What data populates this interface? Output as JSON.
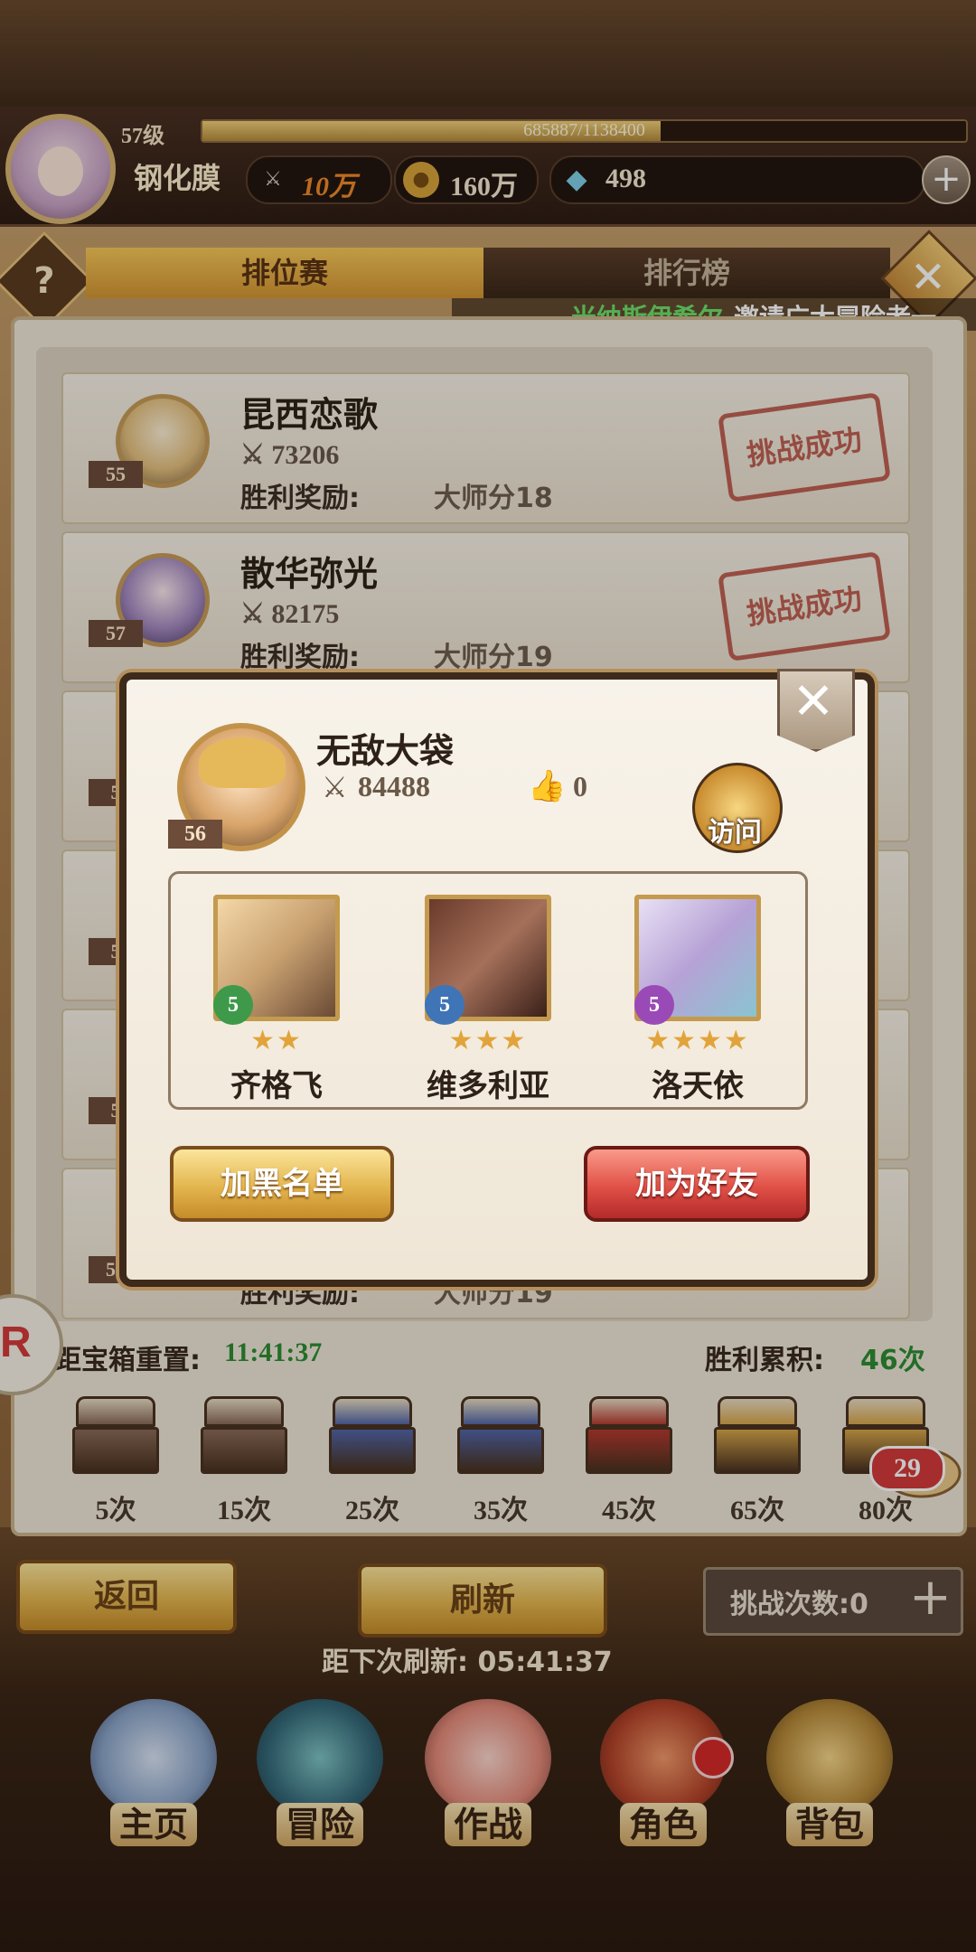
{
  "player": {
    "level": "57级",
    "exp": "685887/1138400",
    "exp_fraction": 0.6,
    "name": "钢化膜",
    "power": "10万",
    "gold": "160万",
    "gems": "498"
  },
  "tabs": {
    "ranked": "排位赛",
    "leaderboard": "排行榜"
  },
  "ticker": {
    "sender": "米纳斯伊希尔",
    "message": "邀请广大冒险者一"
  },
  "opponents": [
    {
      "level": "55",
      "name": "昆西恋歌",
      "power": "73206",
      "reward_label": "胜利奖励:",
      "reward": "大师分18",
      "stamp": "挑战成功"
    },
    {
      "level": "57",
      "name": "散华弥光",
      "power": "82175",
      "reward_label": "胜利奖励:",
      "reward": "大师分19",
      "stamp": "挑战成功"
    },
    {
      "level": "5"
    },
    {
      "level": "5"
    },
    {
      "level": "5"
    },
    {
      "level": "56",
      "reward_label": "胜利奖励:",
      "reward": "大师分19"
    }
  ],
  "chests": {
    "reset_label": "距宝箱重置:",
    "reset_time": "11:41:37",
    "wins_label": "胜利累积:",
    "wins_value": "46次",
    "items": [
      {
        "label": "5次",
        "color": "#8a6a58"
      },
      {
        "label": "15次",
        "color": "#8a6a58"
      },
      {
        "label": "25次",
        "color": "#5266a8"
      },
      {
        "label": "35次",
        "color": "#5266a8"
      },
      {
        "label": "45次",
        "color": "#b53a30"
      },
      {
        "label": "65次",
        "color": "#d7a64a"
      },
      {
        "label": "80次",
        "color": "#d7a64a"
      }
    ]
  },
  "chat_count": "29",
  "buttons": {
    "back": "返回",
    "refresh": "刷新",
    "challenge_count": "挑战次数:0",
    "next_refresh": "距下次刷新: 05:41:37"
  },
  "nav": [
    {
      "label": "主页",
      "icon": "castle-icon"
    },
    {
      "label": "冒险",
      "icon": "adventure-icon"
    },
    {
      "label": "作战",
      "icon": "battle-icon"
    },
    {
      "label": "角色",
      "icon": "character-book-icon"
    },
    {
      "label": "背包",
      "icon": "backpack-icon"
    }
  ],
  "modal": {
    "name": "无敌大袋",
    "level": "56",
    "power": "84488",
    "likes": "0",
    "visit": "访问",
    "heroes": [
      {
        "name": "齐格飞",
        "rank": "5",
        "stars": 2,
        "badge_color": "#3e9a4a"
      },
      {
        "name": "维多利亚",
        "rank": "5",
        "stars": 3,
        "badge_color": "#3f74b6"
      },
      {
        "name": "洛天依",
        "rank": "5",
        "stars": 4,
        "badge_color": "#9a4ab6"
      }
    ],
    "blacklist": "加黑名单",
    "add_friend": "加为好友"
  }
}
